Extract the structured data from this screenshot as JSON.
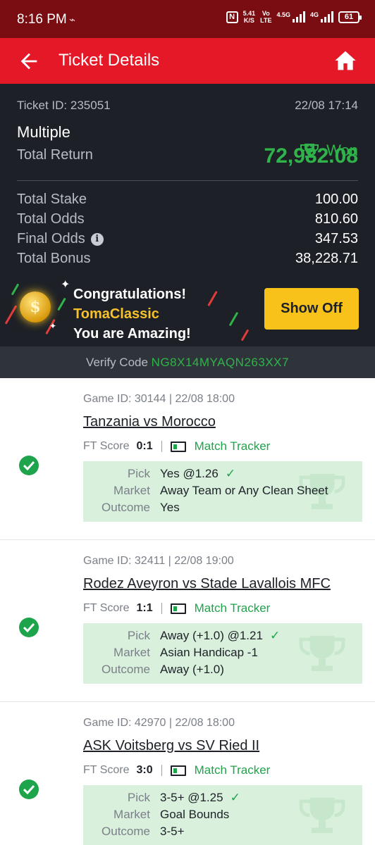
{
  "status_bar": {
    "time": "8:16 PM",
    "net_speed_value": "5.41",
    "net_speed_unit": "K/S",
    "volte_top": "Vo",
    "volte_bottom": "LTE",
    "sig1": "4.5G",
    "sig2": "4G",
    "battery": "61"
  },
  "app_bar": {
    "title": "Ticket Details"
  },
  "summary": {
    "ticket_id": "Ticket ID: 235051",
    "datetime": "22/08 17:14",
    "bet_type": "Multiple",
    "status": "Won",
    "total_return_label": "Total Return",
    "total_return": "72,982.08",
    "rows": [
      {
        "label": "Total Stake",
        "value": "100.00"
      },
      {
        "label": "Total Odds",
        "value": "810.60"
      },
      {
        "label": "Final Odds",
        "value": "347.53"
      },
      {
        "label": "Total Bonus",
        "value": "38,228.71"
      }
    ]
  },
  "congrats": {
    "line1": "Congratulations!",
    "username": "TomaClassic",
    "line3": "You are Amazing!",
    "button": "Show Off"
  },
  "verify": {
    "label": "Verify Code",
    "code": "NG8X14MYAQN263XX7"
  },
  "games": [
    {
      "game_id": "Game ID: 30144 | 22/08 18:00",
      "title": "Tanzania vs Morocco",
      "score_label": "FT Score",
      "score": "0:1",
      "tracker": "Match Tracker",
      "pick_label": "Pick",
      "pick": "Yes @1.26",
      "market_label": "Market",
      "market": "Away Team or Any Clean Sheet",
      "outcome_label": "Outcome",
      "outcome": "Yes"
    },
    {
      "game_id": "Game ID: 32411 | 22/08 19:00",
      "title": "Rodez Aveyron vs Stade Lavallois MFC",
      "score_label": "FT Score",
      "score": "1:1",
      "tracker": "Match Tracker",
      "pick_label": "Pick",
      "pick": "Away (+1.0) @1.21",
      "market_label": "Market",
      "market": "Asian Handicap -1",
      "outcome_label": "Outcome",
      "outcome": "Away (+1.0)"
    },
    {
      "game_id": "Game ID: 42970 | 22/08 18:00",
      "title": "ASK Voitsberg vs SV Ried II",
      "score_label": "FT Score",
      "score": "3:0",
      "tracker": "Match Tracker",
      "pick_label": "Pick",
      "pick": "3-5+ @1.25",
      "market_label": "Market",
      "market": "Goal Bounds",
      "outcome_label": "Outcome",
      "outcome": "3-5+"
    }
  ],
  "colors": {
    "brand_red": "#e41827",
    "won_green": "#2fb34a",
    "button_yellow": "#f9c21b",
    "dark_bg": "#1d2127"
  },
  "icons": [
    "back-arrow-icon",
    "home-icon",
    "trophy-icon",
    "info-icon",
    "coin-icon",
    "check-circle-icon",
    "match-tracker-icon"
  ]
}
